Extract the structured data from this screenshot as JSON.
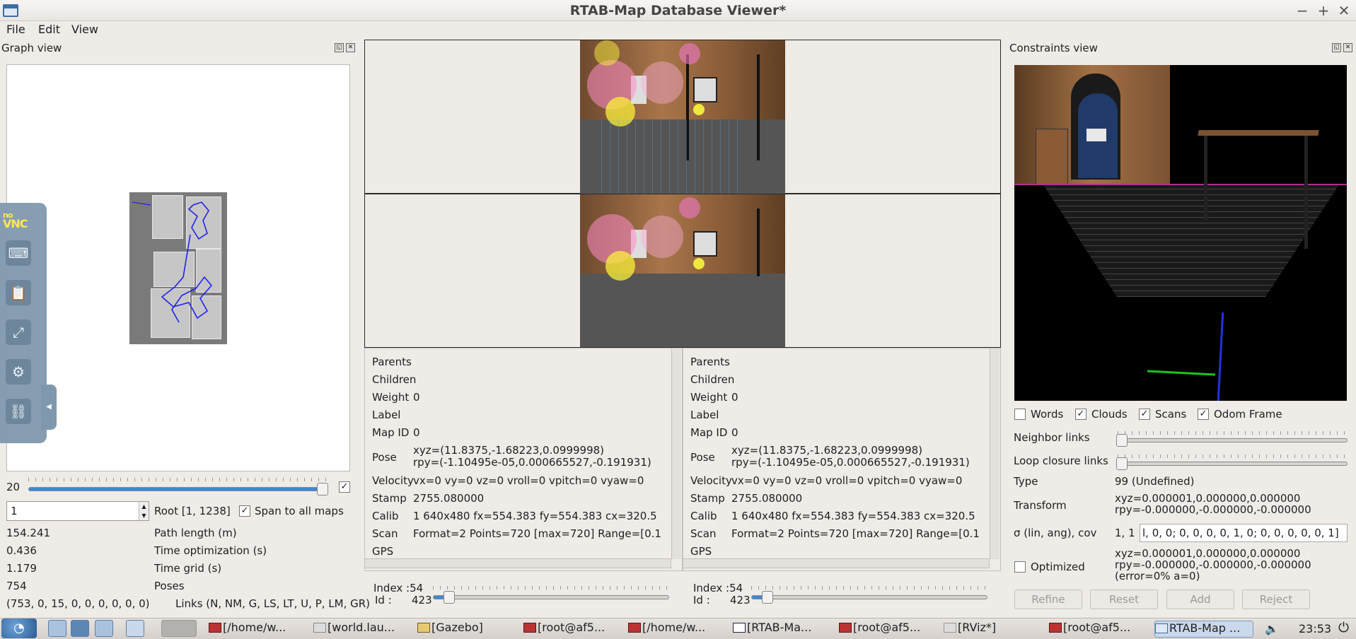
{
  "window": {
    "title": "RTAB-Map Database Viewer*",
    "controls": [
      "−",
      "+",
      "✕"
    ]
  },
  "menu": [
    "File",
    "Edit",
    "View"
  ],
  "graph_view": {
    "title": "Graph view",
    "slider_value": "20",
    "slider_fraction": 0.98,
    "root_spin_value": "1",
    "root_label": "Root [1, 1238]",
    "span_all_maps_label": "Span to all maps",
    "span_all_maps_checked": true,
    "stats": [
      {
        "value": "154.241",
        "label": "Path length (m)"
      },
      {
        "value": "0.436",
        "label": "Time optimization (s)"
      },
      {
        "value": "1.179",
        "label": "Time grid (s)"
      },
      {
        "value": "754",
        "label": "Poses"
      },
      {
        "value": "(753, 0, 15, 0, 0, 0, 0, 0, 0)",
        "label": "Links (N, NM, G, LS, LT, U, P, LM, GR)"
      }
    ]
  },
  "novnc": {
    "logo_top": "no",
    "logo_bottom": "VNC",
    "buttons": [
      "keyboard-icon",
      "clipboard-icon",
      "fullscreen-icon",
      "settings-icon",
      "disconnect-icon"
    ]
  },
  "info_panels": [
    {
      "rows": [
        {
          "key": "Parents",
          "value": ""
        },
        {
          "key": "Children",
          "value": ""
        },
        {
          "key": "Weight",
          "value": "0"
        },
        {
          "key": "Label",
          "value": ""
        },
        {
          "key": "Map ID",
          "value": "0"
        },
        {
          "key": "Pose",
          "value": "xyz=(11.8375,-1.68223,0.0999998)",
          "value2": "rpy=(-1.10495e-05,0.000665527,-0.191931)"
        },
        {
          "key": "Velocity",
          "value": "vx=0 vy=0 vz=0 vroll=0 vpitch=0 vyaw=0"
        },
        {
          "key": "Stamp",
          "value": "2755.080000"
        },
        {
          "key": "Calib",
          "value": "1 640x480 fx=554.383 fy=554.383 cx=320.5"
        },
        {
          "key": "Scan",
          "value": "Format=2 Points=720 [max=720] Range=[0.1"
        },
        {
          "key": "GPS",
          "value": ""
        }
      ],
      "index_label": "Index :",
      "index_value": "54",
      "id_label": "Id :",
      "id_value": "423",
      "slider_fraction": 0.07
    },
    {
      "rows": [
        {
          "key": "Parents",
          "value": ""
        },
        {
          "key": "Children",
          "value": ""
        },
        {
          "key": "Weight",
          "value": "0"
        },
        {
          "key": "Label",
          "value": ""
        },
        {
          "key": "Map ID",
          "value": "0"
        },
        {
          "key": "Pose",
          "value": "xyz=(11.8375,-1.68223,0.0999998)",
          "value2": "rpy=(-1.10495e-05,0.000665527,-0.191931)"
        },
        {
          "key": "Velocity",
          "value": "vx=0 vy=0 vz=0 vroll=0 vpitch=0 vyaw=0"
        },
        {
          "key": "Stamp",
          "value": "2755.080000"
        },
        {
          "key": "Calib",
          "value": "1 640x480 fx=554.383 fy=554.383 cx=320.5"
        },
        {
          "key": "Scan",
          "value": "Format=2 Points=720 [max=720] Range=[0.1"
        },
        {
          "key": "GPS",
          "value": ""
        }
      ],
      "index_label": "Index :",
      "index_value": "54",
      "id_label": "Id :",
      "id_value": "423",
      "slider_fraction": 0.07
    }
  ],
  "constraints_view": {
    "title": "Constraints view",
    "checkboxes": [
      {
        "label": "Words",
        "checked": false
      },
      {
        "label": "Clouds",
        "checked": true
      },
      {
        "label": "Scans",
        "checked": true
      },
      {
        "label": "Odom Frame",
        "checked": true
      }
    ],
    "neighbor_links_label": "Neighbor links",
    "loop_closure_links_label": "Loop closure links",
    "type_label": "Type",
    "type_value": "99  (Undefined)",
    "transform_label": "Transform",
    "transform_line1": "xyz=0.000001,0.000000,0.000000",
    "transform_line2": "rpy=-0.000000,-0.000000,-0.000000",
    "sigma_label": "σ (lin, ang), cov",
    "sigma_value": "1, 1",
    "cov_value": "l, 0, 0;  0, 0, 0, 0, 1, 0;  0, 0, 0, 0, 0, 1]",
    "optimized_label": "Optimized",
    "optimized_checked": false,
    "optimized_line1": "xyz=0.000001,0.000000,0.000000",
    "optimized_line2": "rpy=-0.000000,-0.000000,-0.000000",
    "optimized_line3": "(error=0% a=0)",
    "buttons": [
      "Refine",
      "Reset",
      "Add",
      "Reject"
    ]
  },
  "taskbar": {
    "items": [
      {
        "label": "[/home/w...",
        "icon": "terminal-icon"
      },
      {
        "label": "[world.lau...",
        "icon": "editor-icon"
      },
      {
        "label": "[Gazebo]",
        "icon": "gazebo-icon"
      },
      {
        "label": "[root@af5...",
        "icon": "terminal-icon"
      },
      {
        "label": "[/home/w...",
        "icon": "terminal-icon"
      },
      {
        "label": "[RTAB-Ma...",
        "icon": "rtabmap-icon"
      },
      {
        "label": "[root@af5...",
        "icon": "terminal-icon"
      },
      {
        "label": "[RViz*]",
        "icon": "rviz-icon"
      },
      {
        "label": "[root@af5...",
        "icon": "terminal-icon"
      },
      {
        "label": "RTAB-Map ...",
        "icon": "window-icon"
      }
    ],
    "clock": "23:53"
  },
  "colors": {
    "accent": "#3c88d6",
    "background": "#efebe7",
    "path": "#2222ee"
  }
}
